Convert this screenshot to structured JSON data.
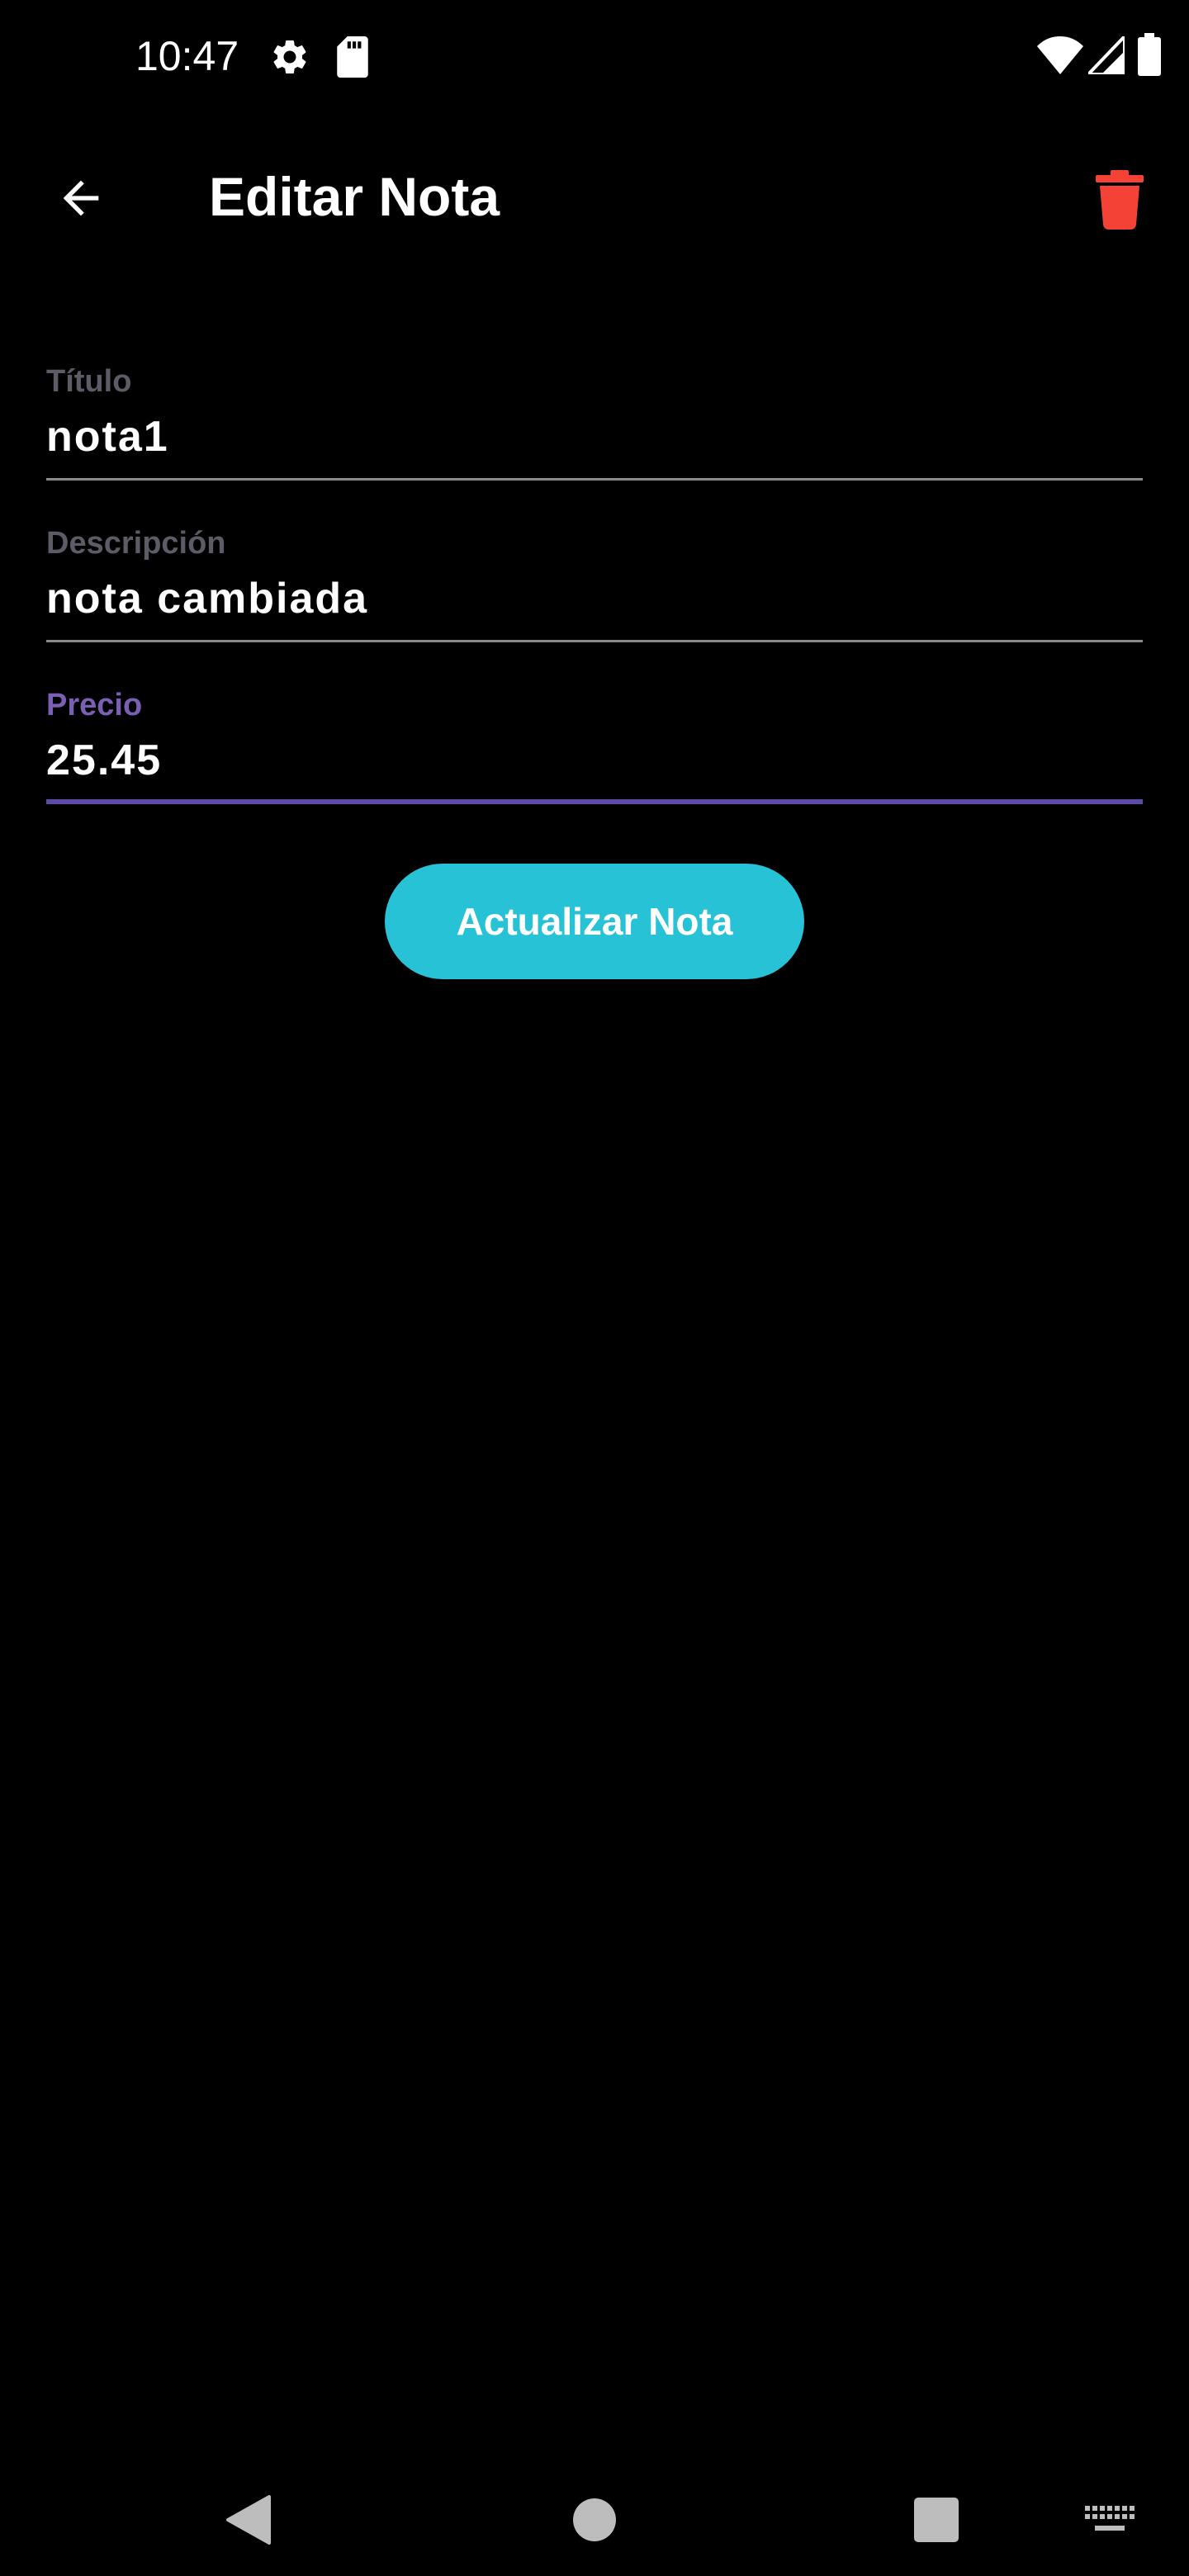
{
  "status_bar": {
    "time": "10:47",
    "icons": [
      "gear-icon",
      "sd-card-icon",
      "wifi-icon",
      "signal-icon",
      "battery-icon"
    ]
  },
  "app_bar": {
    "title": "Editar Nota",
    "back_icon": "arrow-back-icon",
    "delete_icon": "trash-icon",
    "delete_color": "#f44336"
  },
  "form": {
    "fields": [
      {
        "label": "Título",
        "value": "nota1"
      },
      {
        "label": "Descripción",
        "value": "nota cambiada"
      },
      {
        "label": "Precio",
        "value": "25.45",
        "focused": true
      }
    ],
    "focus_color": "#5e4aa8"
  },
  "update_button": {
    "label": "Actualizar Nota",
    "color": "#27c2d6"
  },
  "nav_bar": {
    "items": [
      "back-triangle-icon",
      "home-circle-icon",
      "recents-square-icon",
      "keyboard-icon"
    ]
  }
}
